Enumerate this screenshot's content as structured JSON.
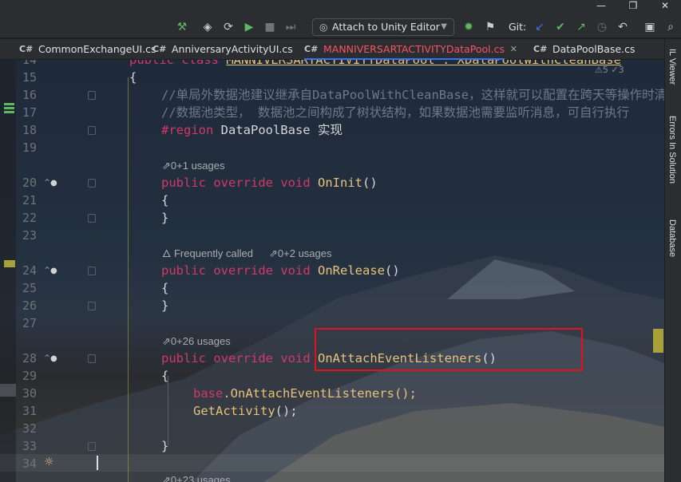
{
  "toolbar": {
    "attach_label": "Attach to Unity Editor",
    "git_label": "Git:"
  },
  "tabs": [
    {
      "label": "CommonExchangeUI.cs",
      "icon": "C#"
    },
    {
      "label": "AnniversaryActivityUI.cs",
      "icon": "C#"
    },
    {
      "label": "MANNIVERSARTACTIVITYDataPool.cs",
      "icon": "C#"
    },
    {
      "label": "DataPoolBase.cs",
      "icon": "C#"
    }
  ],
  "right_panels": {
    "il_viewer": "IL Viewer",
    "errors": "Errors In Solution",
    "database": "Database"
  },
  "analysis": {
    "warnings": "5",
    "weak": "3"
  },
  "hints": {
    "usages_init": "0+1 usages",
    "frequently_called": "Frequently called",
    "usages_release": "0+2 usages",
    "usages_attach": "0+26 usages",
    "usages_next": "0+23 usages"
  },
  "lines": {
    "n14": "14",
    "n15": "15",
    "n16": "16",
    "n17": "17",
    "n18": "18",
    "n19": "19",
    "n20": "20",
    "n21": "21",
    "n22": "22",
    "n23": "23",
    "n24": "24",
    "n25": "25",
    "n26": "26",
    "n27": "27",
    "n28": "28",
    "n29": "29",
    "n30": "30",
    "n31": "31",
    "n32": "32",
    "n33": "33",
    "n34": "34"
  },
  "code": {
    "l14_kw": "public class ",
    "l14_name": "MANNIVERSARTACTIVITYDataPool : XDataPoolWithCleanBase",
    "l15": "{",
    "l16": "//单局外数据池建议继承自DataPoolWithCleanBase，这样就可以配置在跨天等操作时清理数据",
    "l17": "//数据池类型， 数据池之间构成了树状结构，如果数据池需要监听消息，可自行执行",
    "l18_kw": "#region ",
    "l18_rest": "DataPoolBase 实现",
    "kw_public": "public ",
    "kw_override": "override ",
    "kw_void": "void ",
    "fn_init": "OnInit",
    "fn_release": "OnRelease",
    "fn_attach": "OnAttachEventListeners",
    "parens": "()",
    "open": "{",
    "close": "}",
    "base_kw": "base",
    "l30_rest": ".OnAttachEventListeners();",
    "l31_fn": "GetActivity",
    "l31_rest": "();"
  }
}
